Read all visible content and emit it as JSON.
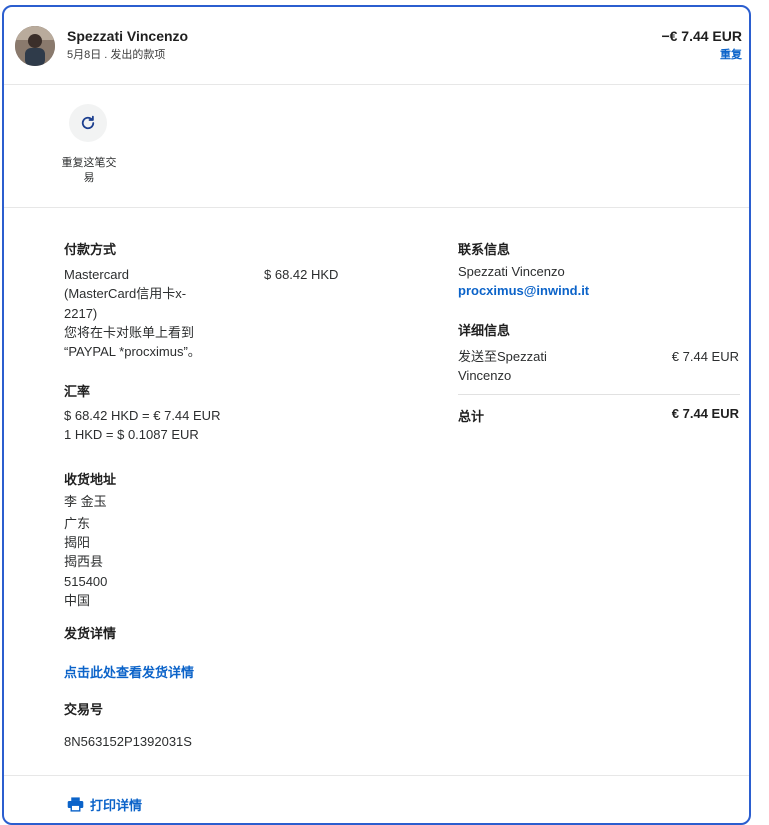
{
  "header": {
    "name": "Spezzati Vincenzo",
    "subtitle": "5月8日 . 发出的款项",
    "amount": "−€ 7.44 EUR",
    "repeat_link": "重复"
  },
  "action": {
    "repeat_label": "重复这笔交易"
  },
  "payment": {
    "heading": "付款方式",
    "method_lines": [
      "Mastercard",
      "(MasterCard信用卡x-",
      "2217)",
      "您将在卡对账单上看到",
      "“PAYPAL *procximus”。"
    ],
    "amount": "$ 68.42 HKD"
  },
  "exchange": {
    "heading": "汇率",
    "line1": "$ 68.42 HKD = € 7.44 EUR",
    "line2": "1 HKD = $ 0.1087 EUR"
  },
  "shipping": {
    "heading": "收货地址",
    "lines": [
      "李 金玉",
      "广东",
      "揭阳",
      "揭西县",
      "515400",
      "中国"
    ]
  },
  "delivery": {
    "heading": "发货详情",
    "link": "点击此处查看发货详情"
  },
  "transaction": {
    "heading": "交易号",
    "id": "8N563152P1392031S"
  },
  "contact": {
    "heading": "联系信息",
    "name": "Spezzati Vincenzo",
    "email": "procximus@inwind.it"
  },
  "details": {
    "heading": "详细信息",
    "item_label_line1": "发送至Spezzati",
    "item_label_line2": "Vincenzo",
    "item_amount": "€ 7.44 EUR",
    "total_label": "总计",
    "total_amount": "€ 7.44 EUR"
  },
  "footer": {
    "print_label": "打印详情"
  },
  "colors": {
    "accent": "#0b63c9",
    "border": "#2b5ecf"
  },
  "icons": {
    "repeat": "refresh-icon",
    "print": "printer-icon"
  }
}
